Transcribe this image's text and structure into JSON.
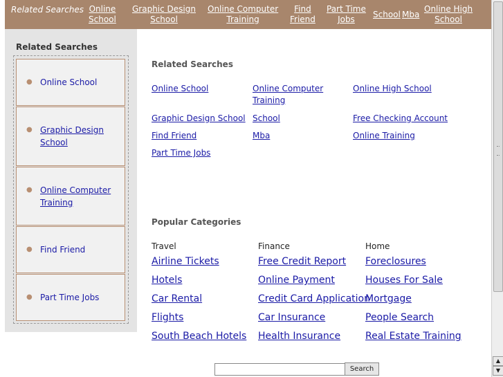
{
  "topbar": {
    "lead": "Related Searches",
    "links": [
      {
        "label": "Online\nSchool"
      },
      {
        "label": "Graphic Design\nSchool"
      },
      {
        "label": "Online Computer\nTraining"
      },
      {
        "label": "Find\nFriend"
      },
      {
        "label": "Part Time\nJobs"
      },
      {
        "label": "School"
      },
      {
        "label": "Mba"
      },
      {
        "label": "Online High\nSchool"
      }
    ]
  },
  "sidebar": {
    "title": "Related Searches",
    "items": [
      {
        "label": "Online School"
      },
      {
        "label": "Graphic Design School"
      },
      {
        "label": "Online Computer Training"
      },
      {
        "label": "Find Friend"
      },
      {
        "label": "Part Time Jobs"
      }
    ]
  },
  "related": {
    "title": "Related Searches",
    "links": [
      {
        "label": "Online School"
      },
      {
        "label": "Online Computer Training"
      },
      {
        "label": "Online High School"
      },
      {
        "label": "Graphic Design School"
      },
      {
        "label": "School"
      },
      {
        "label": "Free Checking Account"
      },
      {
        "label": "Find Friend"
      },
      {
        "label": "Mba"
      },
      {
        "label": "Online Training"
      },
      {
        "label": "Part Time Jobs"
      }
    ]
  },
  "popular": {
    "title": "Popular Categories",
    "columns": [
      {
        "heading": "Travel",
        "links": [
          "Airline Tickets",
          "Hotels",
          "Car Rental",
          "Flights",
          "South Beach Hotels"
        ]
      },
      {
        "heading": "Finance",
        "links": [
          "Free Credit Report",
          "Online Payment",
          "Credit Card Application",
          "Car Insurance",
          "Health Insurance"
        ]
      },
      {
        "heading": "Home",
        "links": [
          "Foreclosures",
          "Houses For Sale",
          "Mortgage",
          "People Search",
          "Real Estate Training"
        ]
      }
    ]
  },
  "search": {
    "value": "",
    "button_label": "Search"
  },
  "scrollbar": {
    "up_icon": "scroll-up-arrow-icon",
    "down_icon": "scroll-down-arrow-icon"
  },
  "colors": {
    "topbar_bg": "#a8866c",
    "sidebar_bg": "#e4e4e4",
    "link": "#1a1aa6"
  }
}
